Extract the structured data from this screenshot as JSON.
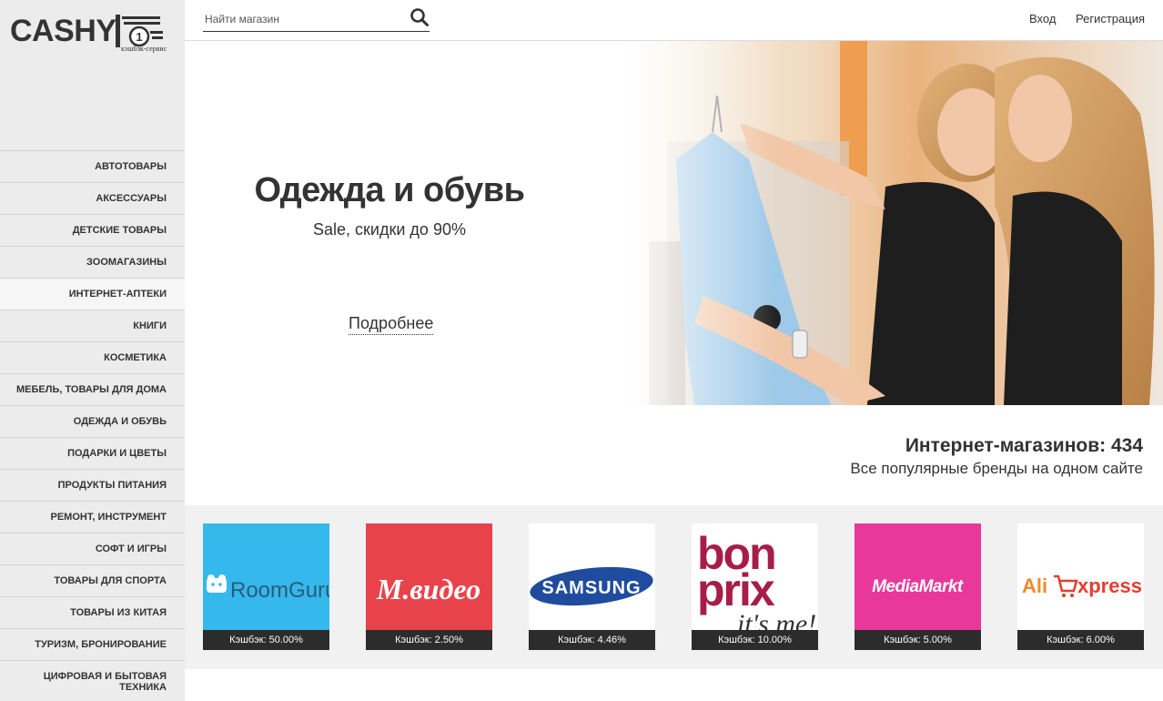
{
  "logo": {
    "text": "CASHY",
    "subtitle": "кэшбэк-сервис",
    "coin_symbol": "1"
  },
  "header": {
    "search_placeholder": "Найти магазин",
    "login": "Вход",
    "register": "Регистрация"
  },
  "sidebar": {
    "items": [
      {
        "label": "АВТОТОВАРЫ"
      },
      {
        "label": "АКСЕССУАРЫ"
      },
      {
        "label": "ДЕТСКИЕ ТОВАРЫ"
      },
      {
        "label": "ЗООМАГАЗИНЫ"
      },
      {
        "label": "ИНТЕРНЕТ-АПТЕКИ",
        "active": true
      },
      {
        "label": "КНИГИ"
      },
      {
        "label": "КОСМЕТИКА"
      },
      {
        "label": "МЕБЕЛЬ, ТОВАРЫ ДЛЯ ДОМА"
      },
      {
        "label": "ОДЕЖДА И ОБУВЬ"
      },
      {
        "label": "ПОДАРКИ И ЦВЕТЫ"
      },
      {
        "label": "ПРОДУКТЫ ПИТАНИЯ"
      },
      {
        "label": "РЕМОНТ, ИНСТРУМЕНТ"
      },
      {
        "label": "СОФТ И ИГРЫ"
      },
      {
        "label": "ТОВАРЫ ДЛЯ СПОРТА"
      },
      {
        "label": "ТОВАРЫ ИЗ КИТАЯ"
      },
      {
        "label": "ТУРИЗМ, БРОНИРОВАНИЕ"
      },
      {
        "label": "ЦИФРОВАЯ И БЫТОВАЯ ТЕХНИКА"
      }
    ]
  },
  "hero": {
    "title": "Одежда и обувь",
    "subtitle": "Sale, скидки до 90%",
    "more": "Подробнее"
  },
  "stats": {
    "title": "Интернет-магазинов: 434",
    "subtitle": "Все популярные бренды на одном сайте"
  },
  "stores": [
    {
      "name": "RoomGuru",
      "cashback": "Кэшбэк: 50.00%",
      "color": "#35b8ec"
    },
    {
      "name": "М.видео",
      "cashback": "Кэшбэк: 2.50%",
      "color": "#e8434b"
    },
    {
      "name": "SAMSUNG",
      "cashback": "Кэшбэк: 4.46%",
      "color": "#1f4c9e"
    },
    {
      "name_line1": "bon",
      "name_line2": "prix",
      "tagline": "it's me!",
      "cashback": "Кэшбэк: 10.00%",
      "color": "#a71d4a"
    },
    {
      "name": "MediaMarkt",
      "cashback": "Кэшбэк: 5.00%",
      "color": "#e8389a"
    },
    {
      "name_part1": "Ali",
      "name_part2": "xpress",
      "cashback": "Кэшбэк: 6.00%",
      "color": "#e43d30"
    }
  ]
}
